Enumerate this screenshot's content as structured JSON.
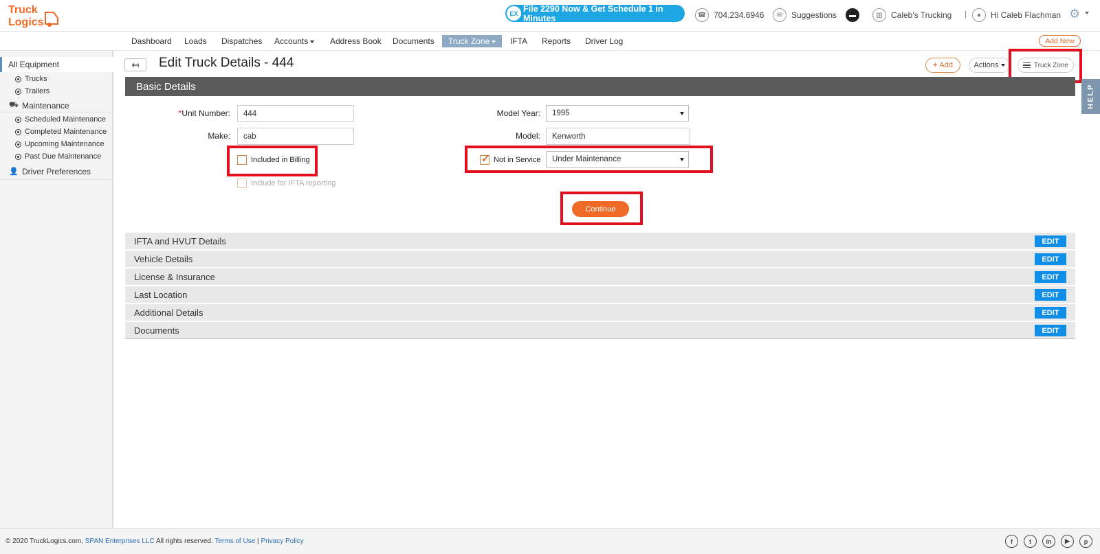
{
  "brand": {
    "logo_line1": "Truck",
    "logo_line2": "Logics",
    "accent": "#ef6a26"
  },
  "header": {
    "promo_icon": "EX",
    "promo": "File 2290 Now & Get Schedule 1 in Minutes",
    "phone": "704.234.6946",
    "suggestions": "Suggestions",
    "company": "Caleb's Trucking",
    "separator": "|",
    "greeting": "Hi Caleb Flachman"
  },
  "nav": {
    "items": [
      "Dashboard",
      "Loads",
      "Dispatches",
      "Accounts",
      "Address Book",
      "Documents",
      "Truck Zone",
      "IFTA",
      "Reports",
      "Driver Log"
    ],
    "add_new": "Add New"
  },
  "sidebar": {
    "all_equipment": "All Equipment",
    "trucks": "Trucks",
    "trailers": "Trailers",
    "maintenance": "Maintenance",
    "scheduled": "Scheduled Maintenance",
    "completed": "Completed Maintenance",
    "upcoming": "Upcoming Maintenance",
    "past_due": "Past Due Maintenance",
    "driver_prefs": "Driver Preferences"
  },
  "page": {
    "title": "Edit Truck Details - 444",
    "add": "Add",
    "actions": "Actions",
    "truck_zone": "Truck Zone",
    "help": "HELP"
  },
  "basic": {
    "heading": "Basic Details",
    "unit_number_req": "*",
    "unit_number_label": "Unit Number:",
    "unit_number": "444",
    "make_label": "Make:",
    "make": "cab",
    "model_year_label": "Model Year:",
    "model_year": "1995",
    "model_label": "Model:",
    "model": "Kenworth",
    "included_billing": "Included in Billing",
    "include_ifta": "Include for IFTA reporting",
    "not_in_service": "Not in Service",
    "service_status": "Under Maintenance",
    "continue": "Continue"
  },
  "sections": [
    {
      "title": "IFTA and HVUT Details",
      "edit": "EDIT"
    },
    {
      "title": "Vehicle Details",
      "edit": "EDIT"
    },
    {
      "title": "License & Insurance",
      "edit": "EDIT"
    },
    {
      "title": "Last Location",
      "edit": "EDIT"
    },
    {
      "title": "Additional Details",
      "edit": "EDIT"
    },
    {
      "title": "Documents",
      "edit": "EDIT"
    }
  ],
  "footer": {
    "copy": "© 2020 TruckLogics.com, ",
    "company_link": "SPAN Enterprises LLC",
    "rights": " All rights reserved. ",
    "terms": "Terms of Use",
    "sep": " | ",
    "privacy": "Privacy Policy",
    "social": [
      "f",
      "t",
      "in",
      "▶",
      "p"
    ]
  }
}
